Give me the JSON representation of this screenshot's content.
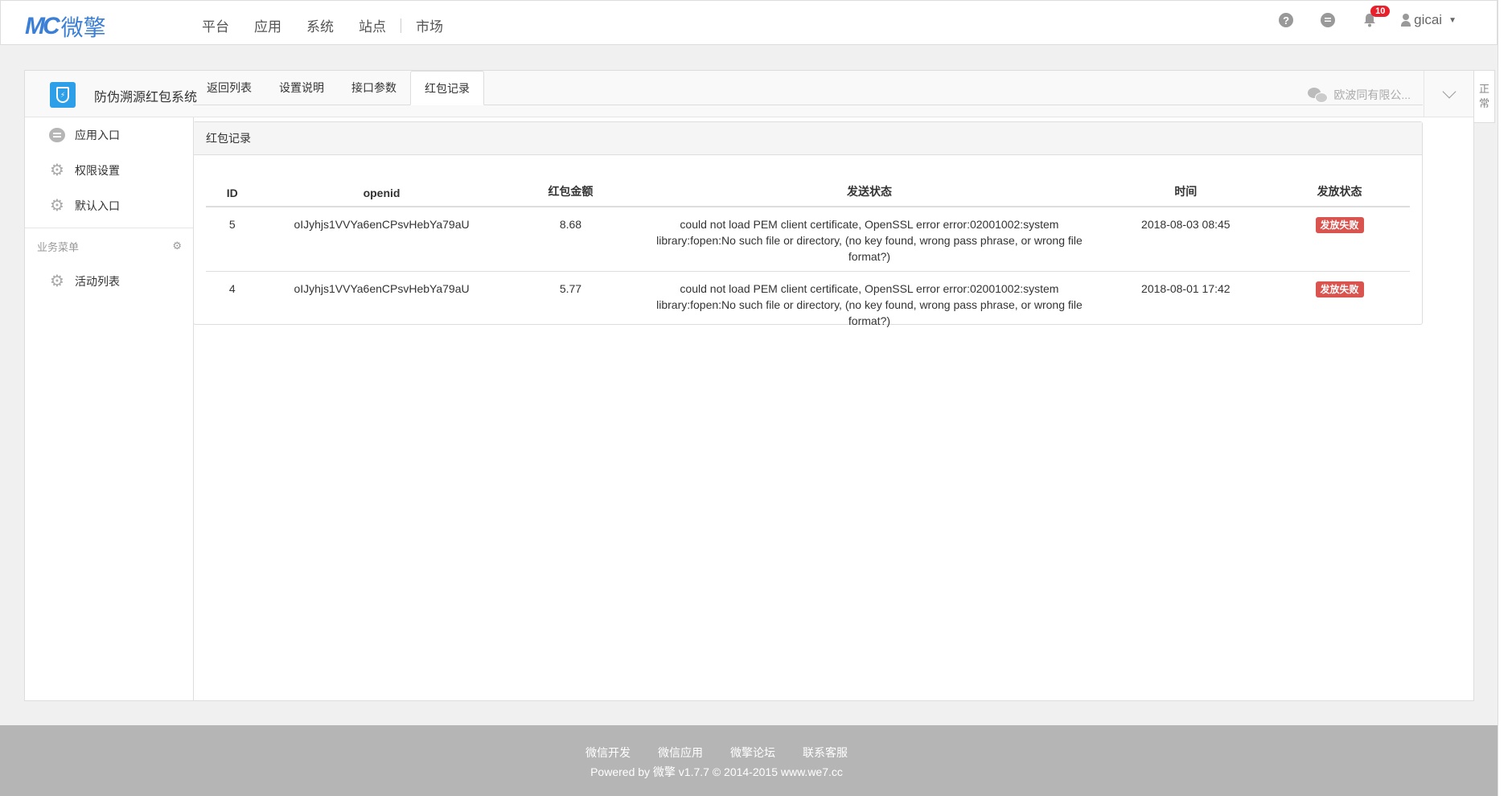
{
  "brand": {
    "mark": "MC",
    "name": "微擎"
  },
  "topnav": {
    "items": [
      "平台",
      "应用",
      "系统",
      "站点",
      "市场"
    ]
  },
  "topbar": {
    "help_icon": "?",
    "notification_count": "10",
    "username": "gicai"
  },
  "app": {
    "title": "防伪溯源红包系统",
    "account_name": "欧波同有限公...",
    "side_tab": "正常"
  },
  "sidebar": {
    "items": [
      {
        "label": "应用入口",
        "icon": "chat-bubble-icon"
      },
      {
        "label": "权限设置",
        "icon": "gear-icon"
      },
      {
        "label": "默认入口",
        "icon": "gear-icon"
      }
    ],
    "group_title": "业务菜单",
    "group_items": [
      {
        "label": "活动列表",
        "icon": "gear-icon"
      }
    ]
  },
  "tabs": [
    "返回列表",
    "设置说明",
    "接口参数",
    "红包记录"
  ],
  "records": {
    "title": "红包记录",
    "columns": [
      "ID",
      "openid",
      "红包金额",
      "发送状态",
      "时间",
      "发放状态"
    ],
    "rows": [
      {
        "id": "5",
        "openid": "oIJyhjs1VVYa6enCPsvHebYa79aU",
        "amount": "8.68",
        "send_status": "could not load PEM client certificate, OpenSSL error error:02001002:system library:fopen:No such file or directory, (no key found, wrong pass phrase, or wrong file format?)",
        "time": "2018-08-03 08:45",
        "status": "发放失败"
      },
      {
        "id": "4",
        "openid": "oIJyhjs1VVYa6enCPsvHebYa79aU",
        "amount": "5.77",
        "send_status": "could not load PEM client certificate, OpenSSL error error:02001002:system library:fopen:No such file or directory, (no key found, wrong pass phrase, or wrong file format?)",
        "time": "2018-08-01 17:42",
        "status": "发放失败"
      }
    ]
  },
  "footer": {
    "links": [
      "微信开发",
      "微信应用",
      "微擎论坛",
      "联系客服"
    ],
    "copyright": "Powered by 微擎 v1.7.7 © 2014-2015 www.we7.cc"
  },
  "colors": {
    "brand": "#3b7fd6",
    "app_icon": "#2d9ee8",
    "danger": "#d9534f",
    "badge": "#e8202c",
    "footer_bg": "#b5b5b5"
  }
}
